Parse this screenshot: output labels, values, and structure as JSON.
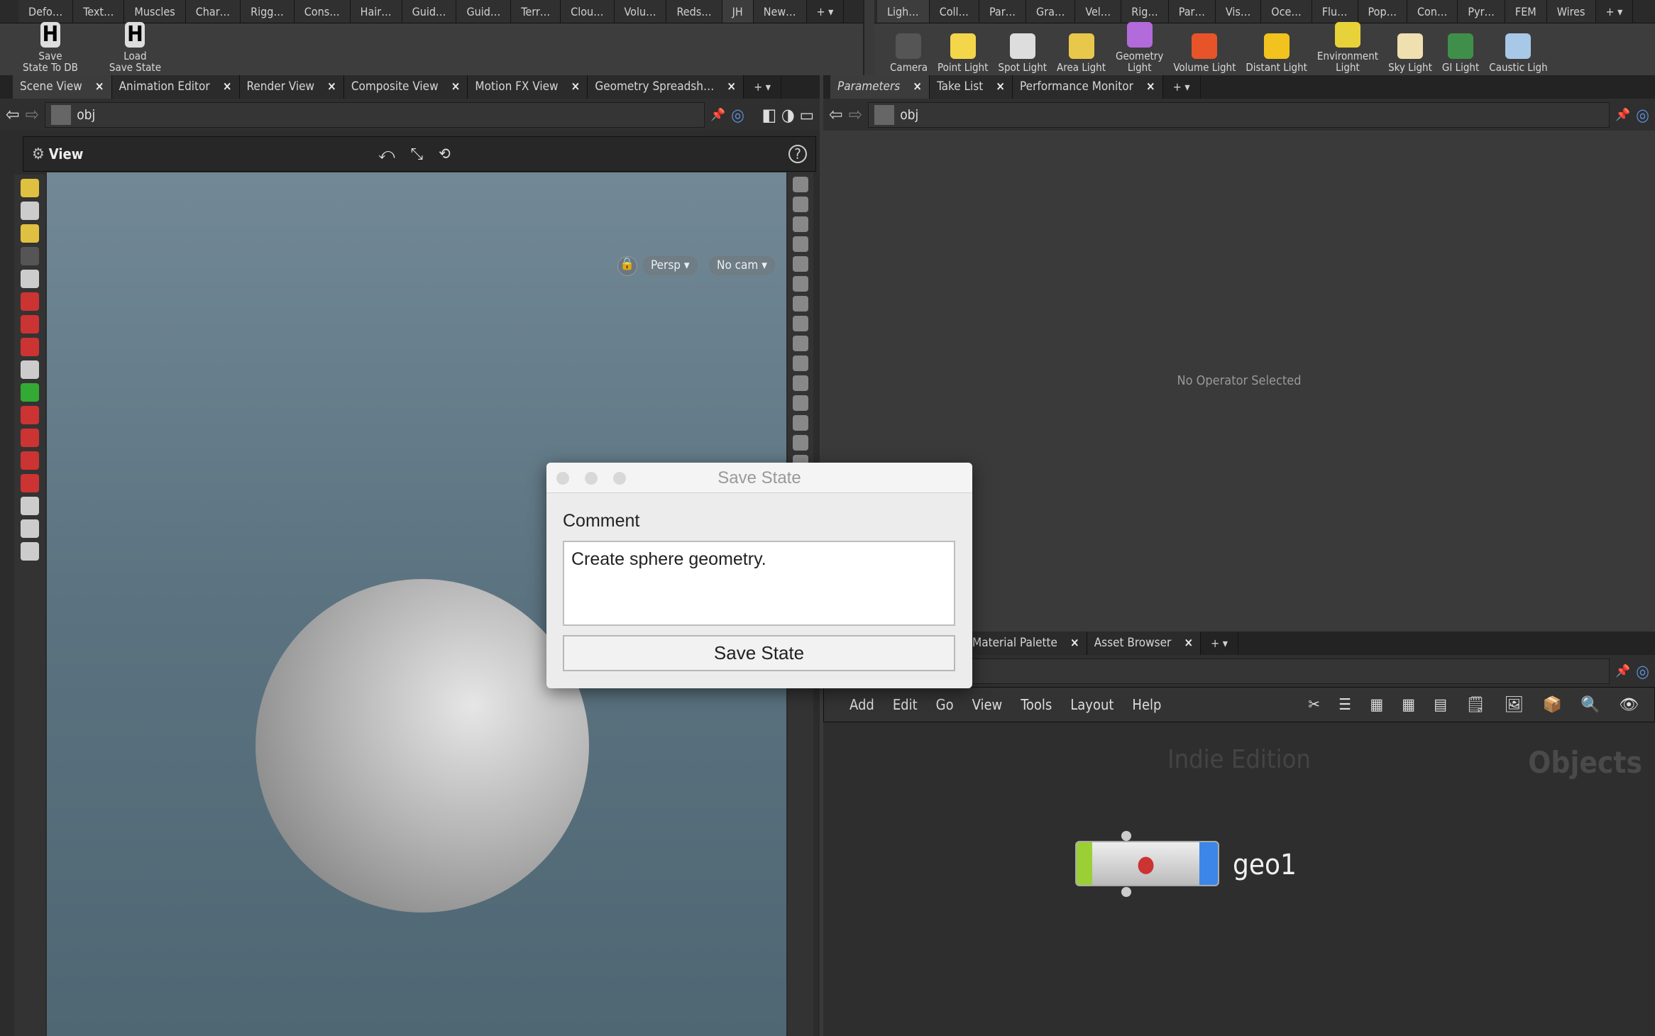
{
  "shelf_left": {
    "tabs": [
      "Defo…",
      "Text…",
      "Muscles",
      "Char…",
      "Rigg…",
      "Cons…",
      "Hair…",
      "Guid…",
      "Guid…",
      "Terr…",
      "Clou…",
      "Volu…",
      "Reds…",
      "JH",
      "New…"
    ],
    "active": "JH",
    "tools": [
      {
        "label": "Save\nState To DB",
        "icon": "houdini-h-icon"
      },
      {
        "label": "Load\nSave State",
        "icon": "houdini-h-icon"
      }
    ]
  },
  "shelf_right": {
    "tabs": [
      "Ligh…",
      "Coll…",
      "Par…",
      "Gra…",
      "Vel…",
      "Rig…",
      "Par…",
      "Vis…",
      "Oce…",
      "Flu…",
      "Pop…",
      "Con…",
      "Pyr…",
      "FEM",
      "Wires"
    ],
    "active": "Ligh…",
    "tools": [
      {
        "label": "Camera",
        "color": "#555"
      },
      {
        "label": "Point Light",
        "color": "#f3d64a"
      },
      {
        "label": "Spot Light",
        "color": "#ddd"
      },
      {
        "label": "Area Light",
        "color": "#e8c84a"
      },
      {
        "label": "Geometry\nLight",
        "color": "#b36adb"
      },
      {
        "label": "Volume Light",
        "color": "#e8542a"
      },
      {
        "label": "Distant Light",
        "color": "#f2c21e"
      },
      {
        "label": "Environment\nLight",
        "color": "#e8d23a"
      },
      {
        "label": "Sky Light",
        "color": "#f0e0b0"
      },
      {
        "label": "GI Light",
        "color": "#3f8f4a"
      },
      {
        "label": "Caustic Ligh",
        "color": "#a8c8e8"
      }
    ]
  },
  "left_pane": {
    "tabs": [
      "Scene View",
      "Animation Editor",
      "Render View",
      "Composite View",
      "Motion FX View",
      "Geometry Spreadsh…"
    ],
    "active": "Scene View",
    "path": "obj",
    "toolbar_title": "View",
    "viewport": {
      "camera_menu": "Persp",
      "cam_menu": "No cam"
    }
  },
  "right_pane": {
    "tabs": [
      "Parameters",
      "Take List",
      "Performance Monitor"
    ],
    "active": "Parameters",
    "path": "obj",
    "empty_message": "No Operator Selected"
  },
  "network_pane": {
    "tabs": [
      "Material Palette",
      "Asset Browser"
    ],
    "menu": [
      "Add",
      "Edit",
      "Go",
      "View",
      "Tools",
      "Layout",
      "Help"
    ],
    "watermark": "Indie Edition",
    "context": "Objects",
    "node": {
      "name": "geo1"
    }
  },
  "dialog": {
    "title": "Save State",
    "comment_label": "Comment",
    "comment_value": "Create sphere geometry.",
    "button": "Save State"
  }
}
